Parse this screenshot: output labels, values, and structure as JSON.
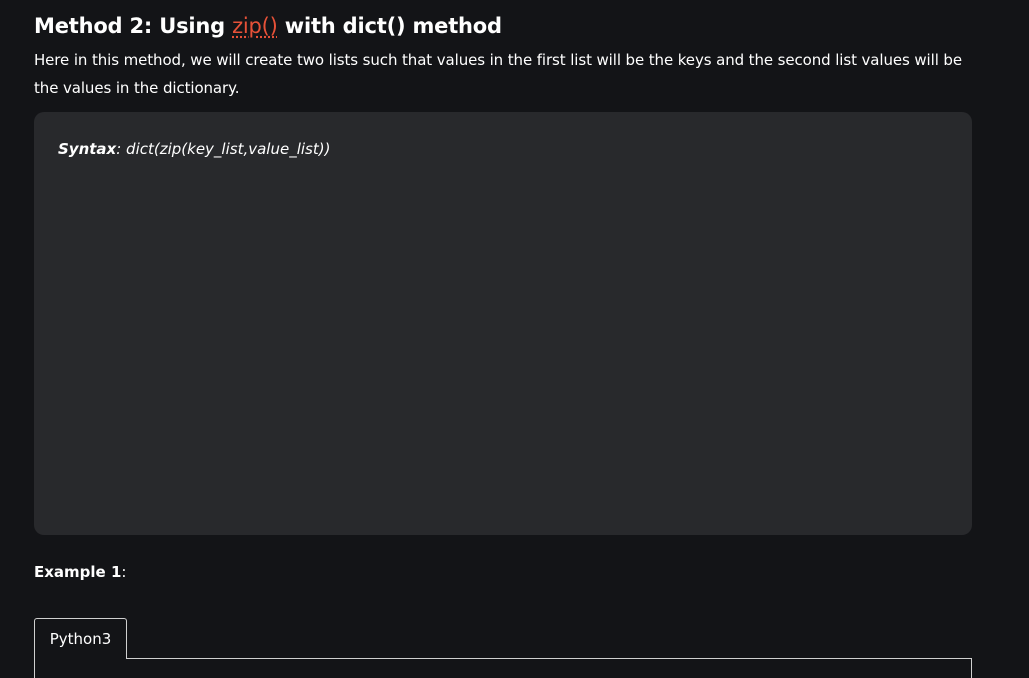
{
  "heading": {
    "prefix": "Method 2: Using ",
    "link_text": "zip()",
    "suffix": " with dict() method"
  },
  "intro": "Here in this method, we will create two lists such that values in the first list will be the keys and the second list values will be the values in the dictionary.",
  "syntax": {
    "label": "Syntax",
    "code": ": dict(zip(key_list,value_list))"
  },
  "example": {
    "label": "Example 1",
    "suffix": ":"
  },
  "code_tabs": [
    {
      "label": "Python3"
    }
  ],
  "colors": {
    "background": "#131417",
    "syntax_box": "#28292c",
    "link": "#e65138",
    "text": "#ffffff"
  }
}
